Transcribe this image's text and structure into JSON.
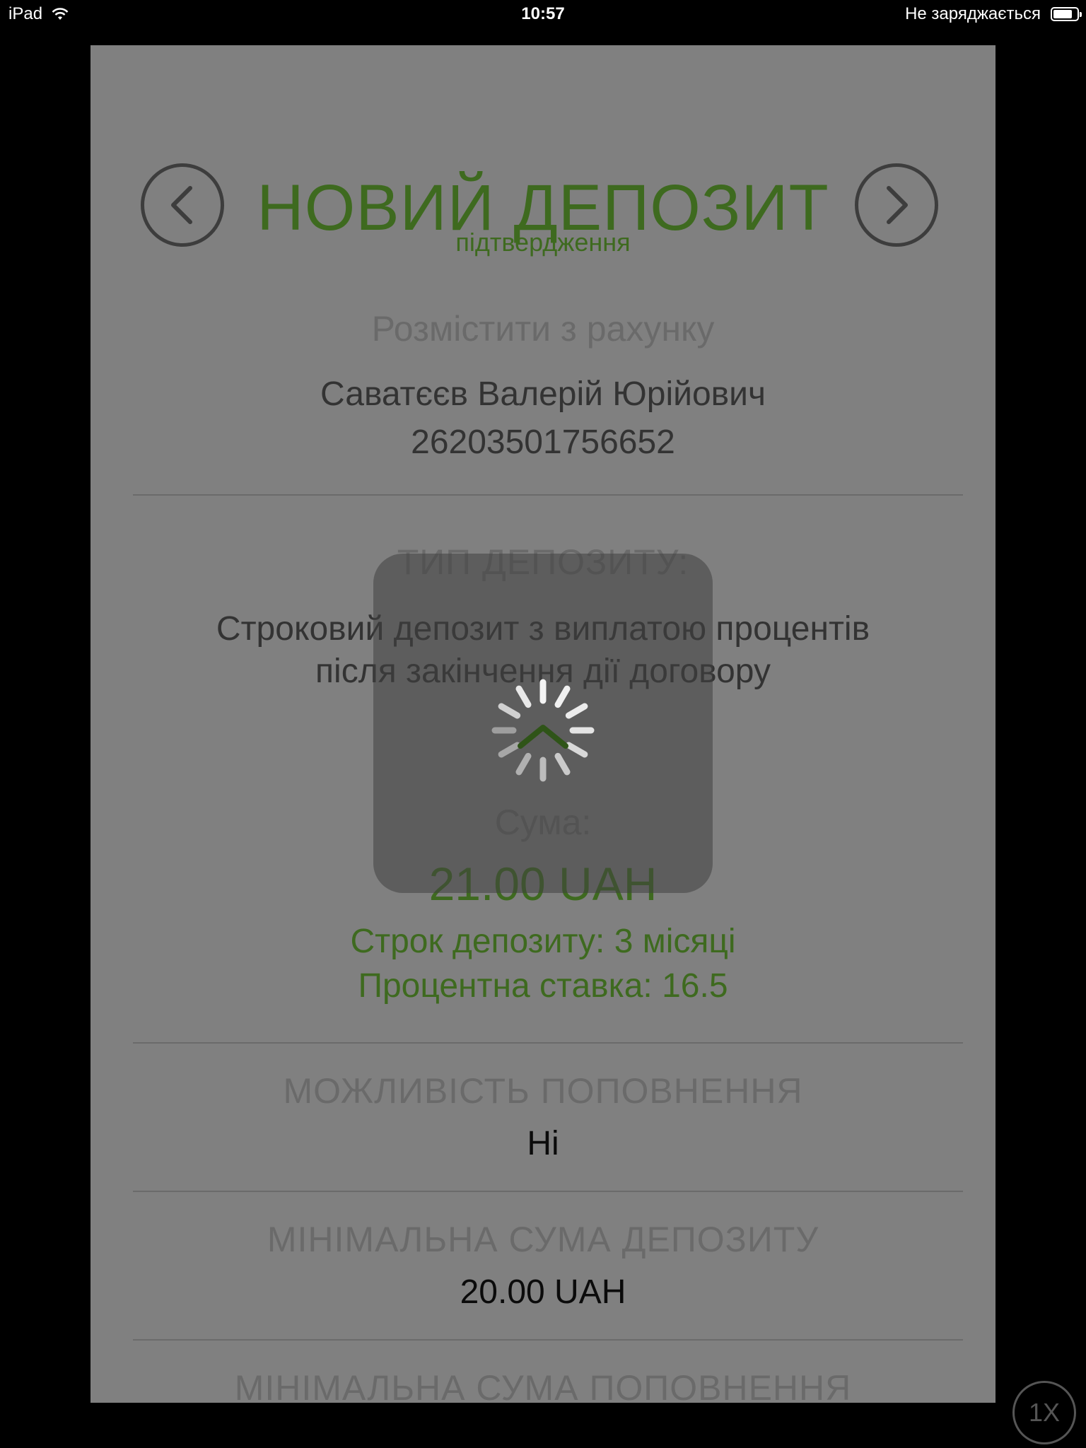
{
  "status_bar": {
    "device": "iPad",
    "time": "10:57",
    "charging_status": "Не заряджається"
  },
  "header": {
    "title": "НОВИЙ ДЕПОЗИТ",
    "subtitle": "підтвердження",
    "prev_icon": "chevron-left-icon",
    "next_icon": "chevron-right-icon"
  },
  "account": {
    "label": "Розмістити з рахунку",
    "owner": "Саватєєв Валерій Юрійович",
    "number": "26203501756652"
  },
  "deposit_type": {
    "label": "ТИП ДЕПОЗИТУ:",
    "line1": "Строковий депозит з виплатою процентів",
    "line2": "після закінчення дії договору"
  },
  "amount": {
    "label": "Сума:",
    "value": "21.00 UAH",
    "term": "Строк депозиту: 3 місяці",
    "rate": "Процентна ставка: 16.5"
  },
  "replenishment": {
    "label": "МОЖЛИВІСТЬ ПОПОВНЕННЯ",
    "value": "Ні"
  },
  "min_deposit": {
    "label": "МІНІМАЛЬНА СУМА ДЕПОЗИТУ",
    "value": "20.00 UAH"
  },
  "min_replenishment": {
    "label": "МІНІМАЛЬНА СУМА ПОПОВНЕННЯ"
  },
  "overlay": {
    "spinner_icon": "loading-spinner-icon"
  },
  "speed_button": "1X",
  "colors": {
    "accent_green": "#3e6a1f",
    "dim_background": "#808080"
  }
}
